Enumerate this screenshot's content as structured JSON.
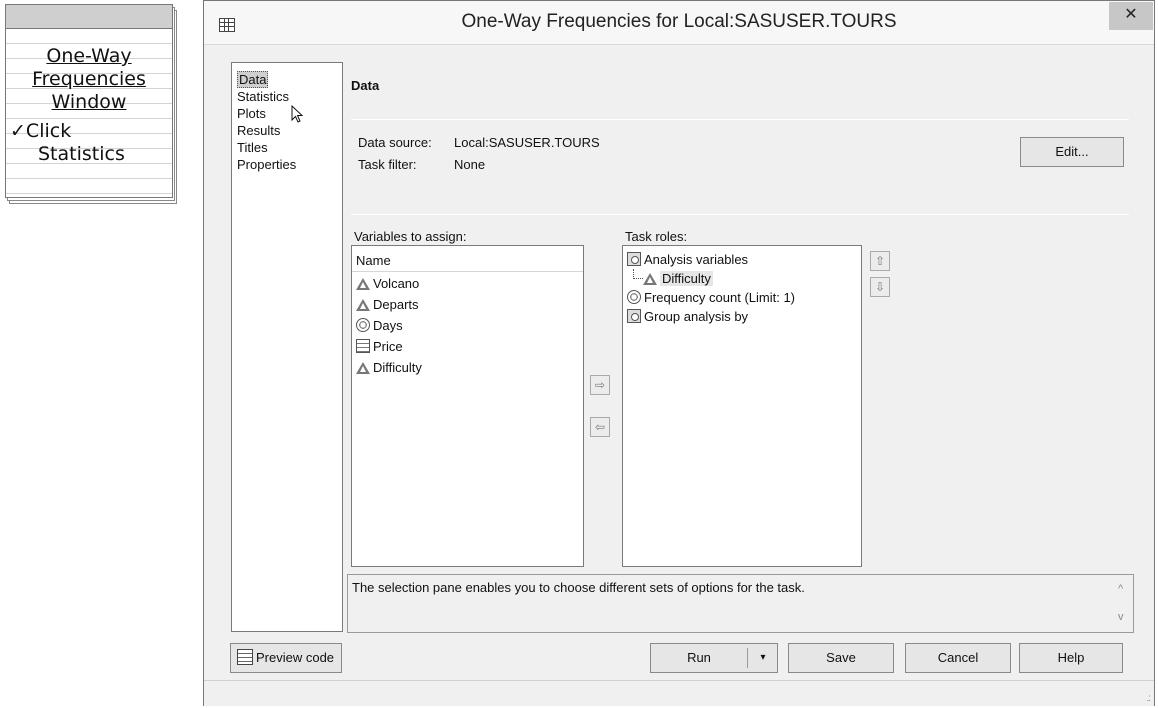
{
  "note": {
    "title_lines": [
      "One-Way",
      "Frequencies",
      "Window"
    ],
    "step_check": "✓",
    "step_line1": "Click",
    "step_line2": "Statistics"
  },
  "dialog": {
    "title": "One-Way Frequencies for Local:SASUSER.TOURS",
    "close": "✕"
  },
  "nav": {
    "items": [
      {
        "label": "Data",
        "selected": true
      },
      {
        "label": "Statistics"
      },
      {
        "label": "Plots"
      },
      {
        "label": "Results"
      },
      {
        "label": "Titles"
      },
      {
        "label": "Properties"
      }
    ]
  },
  "data_section": {
    "title": "Data",
    "data_source_label": "Data source:",
    "data_source_value": "Local:SASUSER.TOURS",
    "task_filter_label": "Task filter:",
    "task_filter_value": "None",
    "edit_button": "Edit..."
  },
  "variables": {
    "label": "Variables to assign:",
    "header": "Name",
    "items": [
      {
        "name": "Volcano",
        "icon": "character-variable-icon"
      },
      {
        "name": "Departs",
        "icon": "character-variable-icon"
      },
      {
        "name": "Days",
        "icon": "numeric-variable-icon"
      },
      {
        "name": "Price",
        "icon": "currency-variable-icon"
      },
      {
        "name": "Difficulty",
        "icon": "character-variable-icon"
      }
    ]
  },
  "arrows": {
    "add": "⇨",
    "remove": "⇦",
    "up": "⇧",
    "down": "⇩"
  },
  "task_roles": {
    "label": "Task roles:",
    "analysis_variables": "Analysis variables",
    "assigned_variable": "Difficulty",
    "frequency_count": "Frequency count (Limit: 1)",
    "group_analysis": "Group analysis by"
  },
  "description": "The selection pane enables you to choose different sets of options for the task.",
  "scroll": {
    "up": "^",
    "down": "v"
  },
  "buttons": {
    "preview": "Preview code",
    "run": "Run",
    "run_dropdown": "▾",
    "save": "Save",
    "cancel": "Cancel",
    "help": "Help"
  },
  "status": {
    "grip": ".:"
  }
}
